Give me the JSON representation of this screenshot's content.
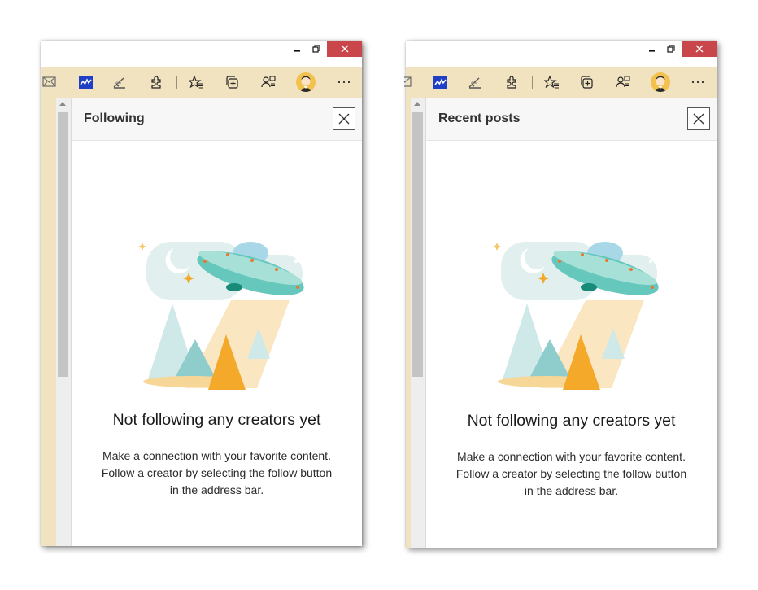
{
  "windows": [
    {
      "id": "left",
      "panel_title": "Following",
      "empty_title": "Not following any creators yet",
      "empty_desc_lines": [
        "Make a connection with your favorite content.",
        "Follow a creator by selecting the follow button",
        "in the address bar."
      ]
    },
    {
      "id": "right",
      "panel_title": "Recent posts",
      "empty_title": "Not following any creators yet",
      "empty_desc_lines": [
        "Make a connection with your favorite content.",
        "Follow a creator by selecting the follow button",
        "in the address bar."
      ]
    }
  ],
  "toolbar_icons": [
    "mail-icon",
    "stock-chart-extension-icon",
    "signature-pen-icon",
    "extensions-puzzle-icon",
    "favorites-icon",
    "collections-icon",
    "follow-creators-icon",
    "profile-avatar",
    "more-options-icon"
  ],
  "window_controls": [
    "minimize-icon",
    "restore-icon",
    "close-icon"
  ],
  "colors": {
    "toolbar_bg": "#f1e3c0",
    "close_button_bg": "#c9474a",
    "tree_light": "#cfe8e8",
    "tree_teal": "#8ecdcc",
    "tree_orange": "#f4a92a",
    "ufo_teal": "#66c7bd",
    "beam": "#fbe6c2"
  }
}
